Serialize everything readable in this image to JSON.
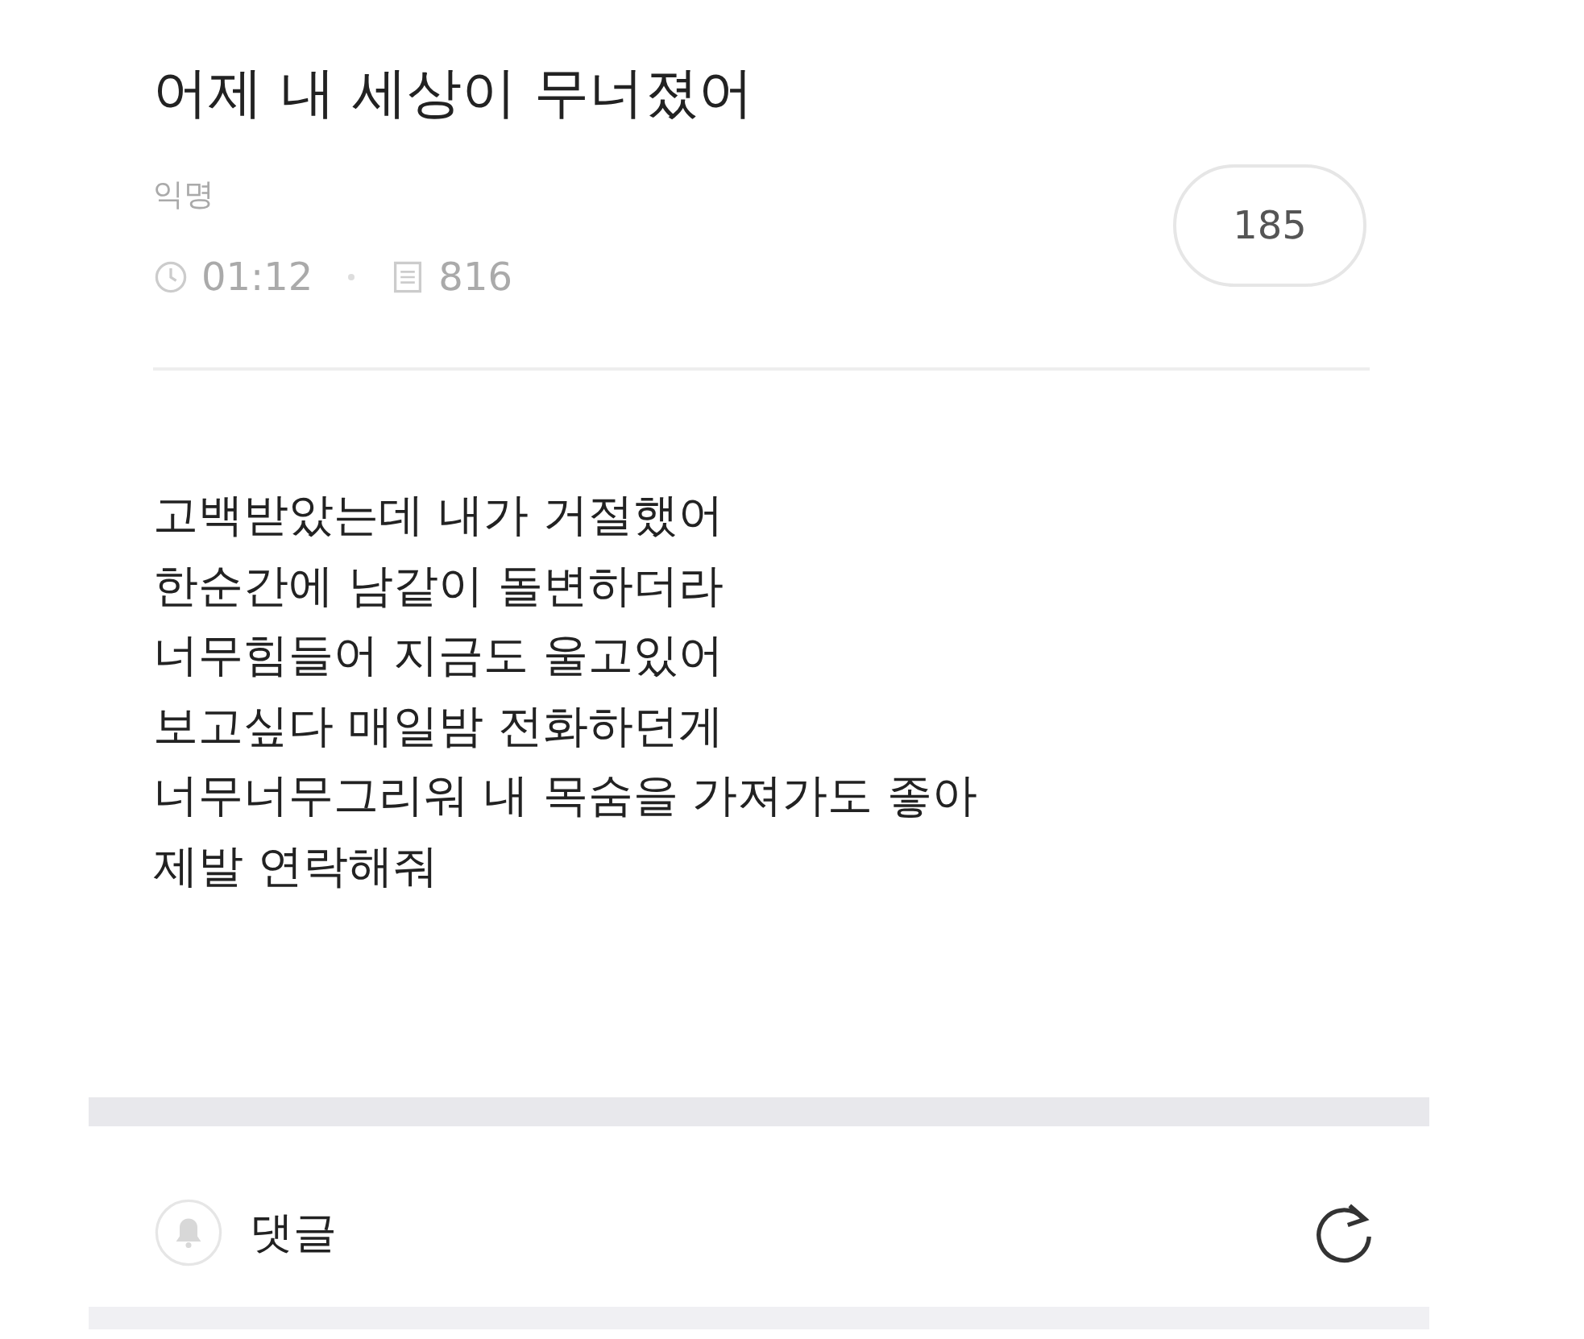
{
  "post": {
    "title": "어제 내 세상이 무너졌어",
    "author": "익명",
    "time": "01:12",
    "views": "816",
    "comment_count": "185",
    "body": [
      "고백받았는데 내가 거절했어",
      "한순간에 남같이 돌변하더라",
      "너무힘들어 지금도 울고있어",
      "보고싶다 매일밤 전화하던게",
      "너무너무그리워 내 목숨을 가져가도 좋아",
      "제발 연락해줘"
    ]
  },
  "comments": {
    "label": "댓글"
  }
}
